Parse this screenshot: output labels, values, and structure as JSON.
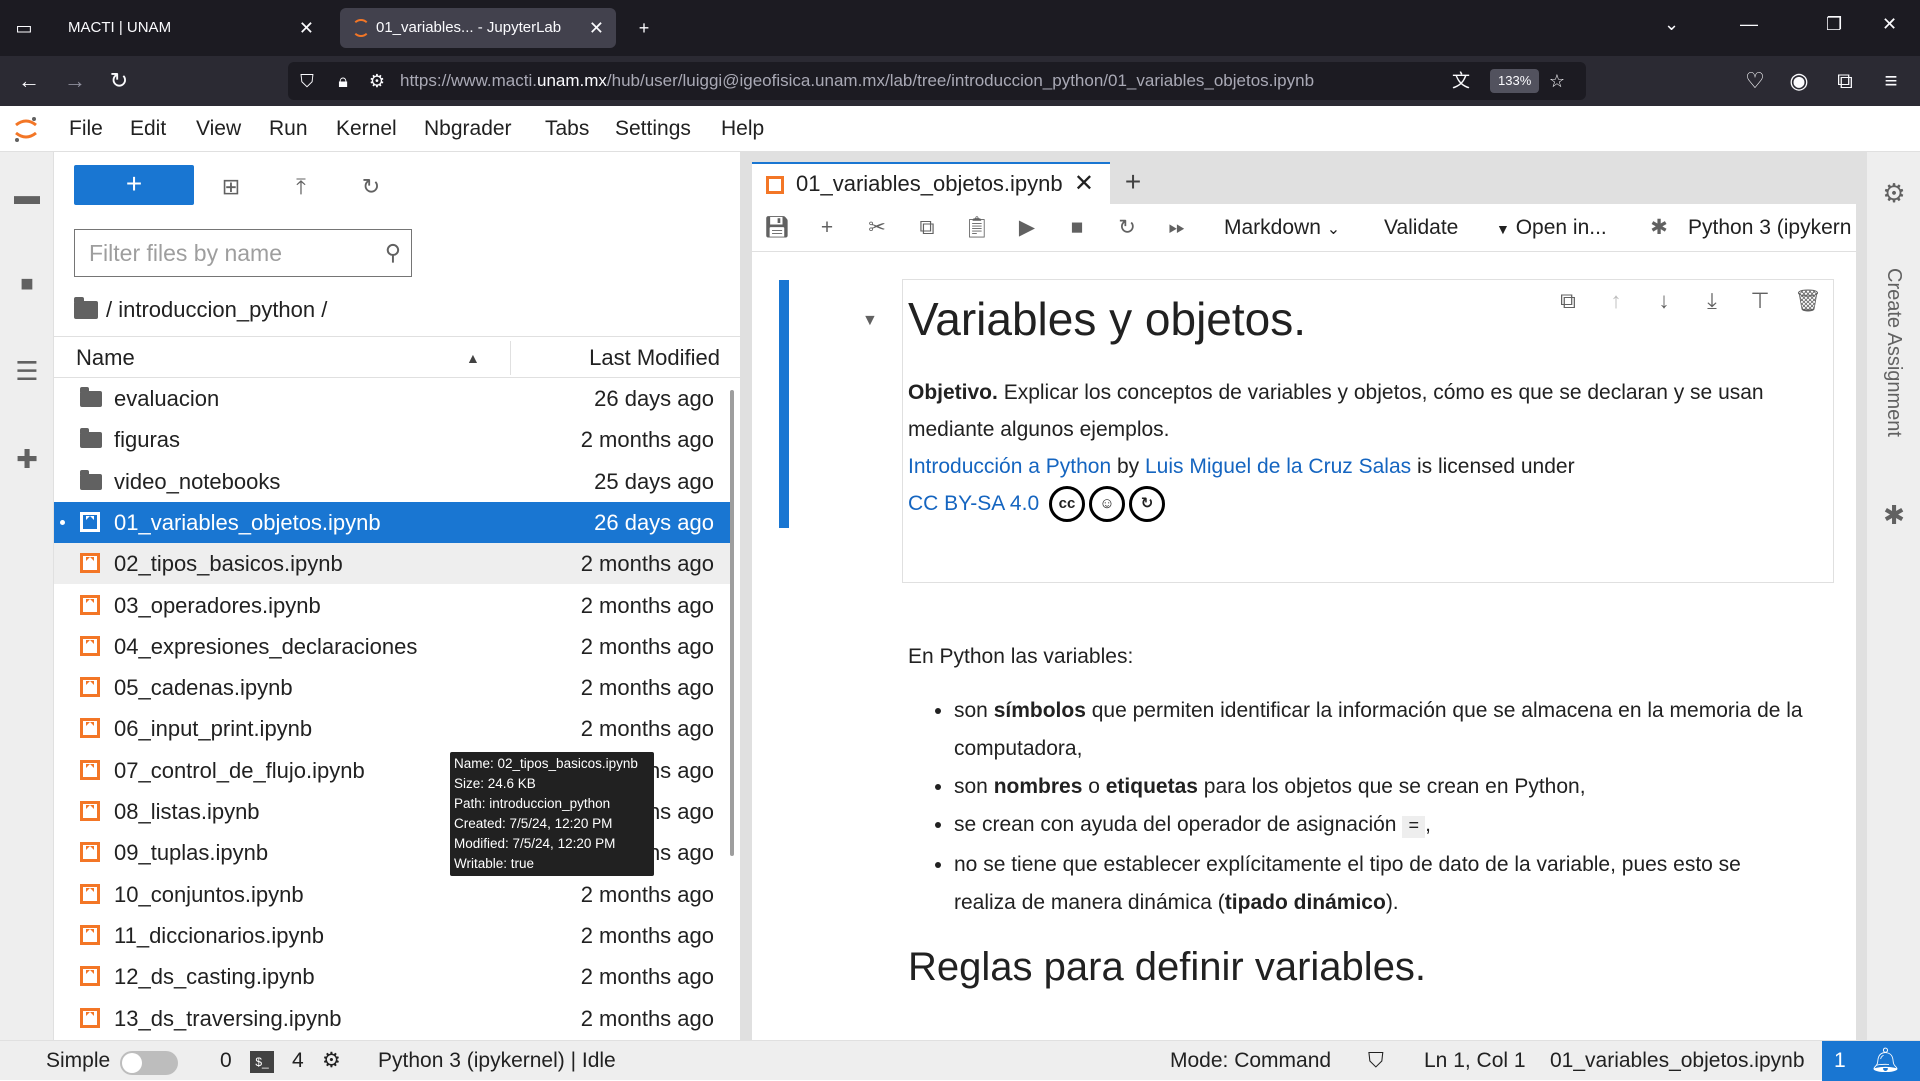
{
  "browser": {
    "tabs": [
      {
        "title": "MACTI | UNAM"
      },
      {
        "title": "01_variables... - JupyterLab"
      }
    ],
    "url_prefix": "https://www.macti.",
    "url_domain": "unam.mx",
    "url_rest": "/hub/user/luiggi@igeofisica.unam.mx/lab/tree/introduccion_python/01_variables_objetos.ipynb",
    "zoom": "133%"
  },
  "menu": {
    "items": [
      "File",
      "Edit",
      "View",
      "Run",
      "Kernel",
      "Nbgrader",
      "Tabs",
      "Settings",
      "Help"
    ]
  },
  "filebrowser": {
    "new_label": "+",
    "filter_placeholder": "Filter files by name",
    "breadcrumb": "/ introduccion_python /",
    "col_name": "Name",
    "col_modified": "Last Modified",
    "items": [
      {
        "name": "evaluacion",
        "modified": "26 days ago",
        "type": "folder"
      },
      {
        "name": "figuras",
        "modified": "2 months ago",
        "type": "folder"
      },
      {
        "name": "video_notebooks",
        "modified": "25 days ago",
        "type": "folder"
      },
      {
        "name": "01_variables_objetos.ipynb",
        "modified": "26 days ago",
        "type": "notebook"
      },
      {
        "name": "02_tipos_basicos.ipynb",
        "modified": "2 months ago",
        "type": "notebook"
      },
      {
        "name": "03_operadores.ipynb",
        "modified": "2 months ago",
        "type": "notebook"
      },
      {
        "name": "04_expresiones_declaraciones",
        "modified": "2 months ago",
        "type": "notebook"
      },
      {
        "name": "05_cadenas.ipynb",
        "modified": "2 months ago",
        "type": "notebook"
      },
      {
        "name": "06_input_print.ipynb",
        "modified": "2 months ago",
        "type": "notebook"
      },
      {
        "name": "07_control_de_flujo.ipynb",
        "modified": "2 months ago",
        "type": "notebook"
      },
      {
        "name": "08_listas.ipynb",
        "modified": "2 months ago",
        "type": "notebook"
      },
      {
        "name": "09_tuplas.ipynb",
        "modified": "2 months ago",
        "type": "notebook"
      },
      {
        "name": "10_conjuntos.ipynb",
        "modified": "2 months ago",
        "type": "notebook"
      },
      {
        "name": "11_diccionarios.ipynb",
        "modified": "2 months ago",
        "type": "notebook"
      },
      {
        "name": "12_ds_casting.ipynb",
        "modified": "2 months ago",
        "type": "notebook"
      },
      {
        "name": "13_ds_traversing.ipynb",
        "modified": "2 months ago",
        "type": "notebook"
      }
    ],
    "tooltip": {
      "line1": "Name: 02_tipos_basicos.ipynb",
      "line2": "Size: 24.6 KB",
      "line3": "Path: introduccion_python",
      "line4": "Created: 7/5/24, 12:20 PM",
      "line5": "Modified: 7/5/24, 12:20 PM",
      "line6": "Writable: true"
    }
  },
  "notebook": {
    "tab_title": "01_variables_objetos.ipynb",
    "toolbar": {
      "cell_type": "Markdown",
      "validate": "Validate",
      "open_in": "Open in...",
      "kernel": "Python 3 (ipykern"
    },
    "content": {
      "h1": "Variables y objetos.",
      "objective_bold": "Objetivo.",
      "objective_text": " Explicar los conceptos de variables y objetos, cómo es que se declaran y se usan mediante algunos ejemplos.",
      "license_link1": "Introducción a Python",
      "license_by": " by ",
      "license_link2": "Luis Miguel de la Cruz Salas",
      "license_text": " is licensed under",
      "license_link3": "CC BY-SA 4.0",
      "intro": "En Python las variables:",
      "b1_pre": "son ",
      "b1_bold": "símbolos",
      "b1_post": " que permiten identificar la información que se almacena en la memoria de la computadora,",
      "b2_pre": "son ",
      "b2_bold1": "nombres",
      "b2_mid": " o ",
      "b2_bold2": "etiquetas",
      "b2_post": " para los objetos que se crean en Python,",
      "b3_pre": "se crean con ayuda del operador de asignación ",
      "b3_code": "=",
      "b3_post": ",",
      "b4_pre": "no se tiene que establecer explícitamente el tipo de dato de la variable, pues esto se realiza de manera dinámica (",
      "b4_bold": "tipado dinámico",
      "b4_post": ").",
      "h2": "Reglas para definir variables."
    }
  },
  "rightbar": {
    "create_assignment": "Create Assignment"
  },
  "status": {
    "mode_label": "Simple",
    "terminals": "0",
    "kernels": "4",
    "kernel_status": "Python 3 (ipykernel) | Idle",
    "mode": "Mode: Command",
    "cursor": "Ln 1, Col 1",
    "file": "01_variables_objetos.ipynb",
    "notifications": "1"
  }
}
